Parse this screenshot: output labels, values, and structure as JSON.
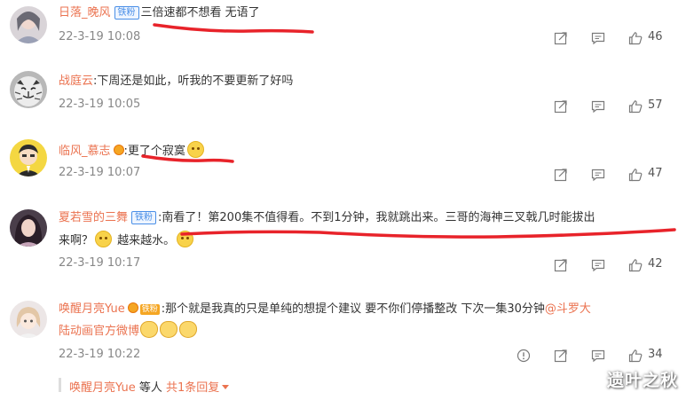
{
  "comments": [
    {
      "username": "日落_晚风",
      "badge": "铁粉",
      "text": "三倍速都不想看 无语了",
      "time": "22-3-19 10:08",
      "likes": "46"
    },
    {
      "username": "战庭云",
      "text": "下周还是如此，听我的不要更新了好吗",
      "time": "22-3-19 10:05",
      "likes": "57"
    },
    {
      "username": "临风_慕志",
      "text": "更了个寂寞",
      "time": "22-3-19 10:07",
      "likes": "47"
    },
    {
      "username": "夏若雪的三舞",
      "badge": "铁粉",
      "text_line1": "南看了！第200集不值得看。不到1分钟，我就跳出来。三哥的海神三叉戟几时能拔出",
      "text_line2": "来啊？",
      "text_line2_tail": "越来越水。",
      "time": "22-3-19 10:17",
      "likes": "42"
    },
    {
      "username": "唤醒月亮Yue",
      "badge": "铁粉",
      "text_line1": "那个就是我真的只是单纯的想提个建议 要不你们停播整改 下次一集30分钟",
      "mention_part1": "@斗罗大",
      "mention_part2": "陆动画官方微博",
      "time": "22-3-19 10:22",
      "likes": "34"
    }
  ],
  "reply_summary": {
    "username": "唤醒月亮Yue",
    "suffix": "等人",
    "count_text": "共1条回复"
  },
  "watermark": "遗叶之秋",
  "colors": {
    "username": "#eb7350",
    "time": "#888888",
    "underline": "#e8232a",
    "badge": "#4a8fe7"
  },
  "icons": [
    "forward-icon",
    "comment-icon",
    "like-icon",
    "report-icon",
    "chevron-down-icon"
  ]
}
